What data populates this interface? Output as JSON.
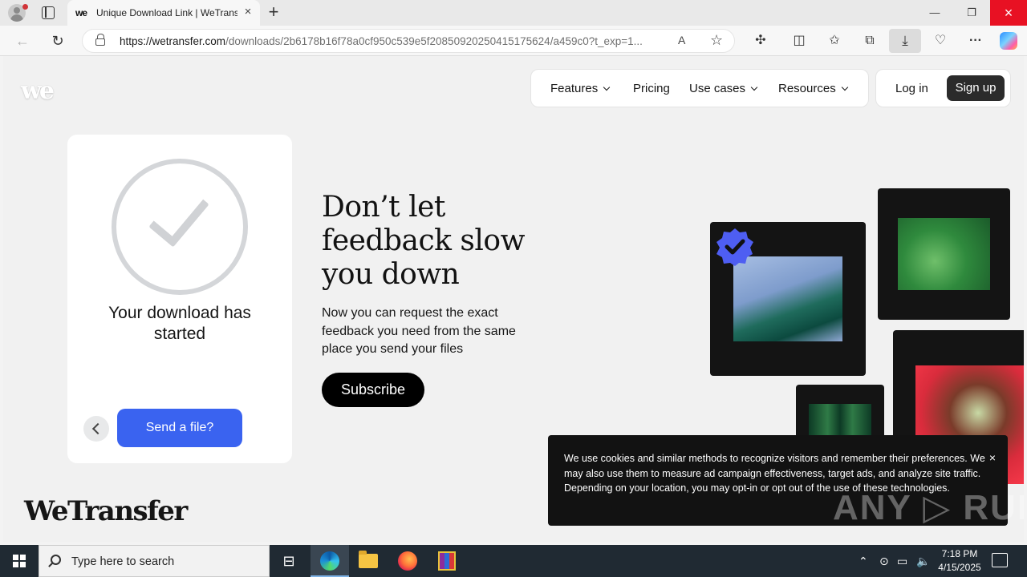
{
  "browser": {
    "tab_favicon": "we",
    "tab_title": "Unique Download Link | WeTransfer",
    "url_host": "https://wetransfer.com",
    "url_path": "/downloads/2b6178b16f78a0cf950c539e5f20850920250415175624/a459c0?t_exp=1...",
    "read_aloud": "A",
    "new_tab": "+",
    "close_tab": "×"
  },
  "site": {
    "logo": "we",
    "nav": {
      "features": "Features",
      "pricing": "Pricing",
      "use_cases": "Use cases",
      "resources": "Resources",
      "login": "Log in",
      "signup": "Sign up"
    },
    "card": {
      "title": "Your download has started",
      "send_label": "Send a file?"
    },
    "promo": {
      "headline": "Don’t let feedback slow you down",
      "body": "Now you can request the exact feedback you need from the same place you send your files",
      "subscribe": "Subscribe"
    },
    "cookie": {
      "text": "We use cookies and similar methods to recognize visitors and remember their preferences. We may also use them to measure ad campaign effectiveness, target ads, and analyze site traffic. Depending on your location, you may opt-in or opt out of the use of these technologies.",
      "close": "×"
    },
    "watermark": "ANY ▷ RUN",
    "wordmark": "WeTransfer",
    "accent_color": "#3a63f0"
  },
  "taskbar": {
    "search_placeholder": "Type here to search",
    "time": "7:18 PM",
    "date": "4/15/2025"
  }
}
